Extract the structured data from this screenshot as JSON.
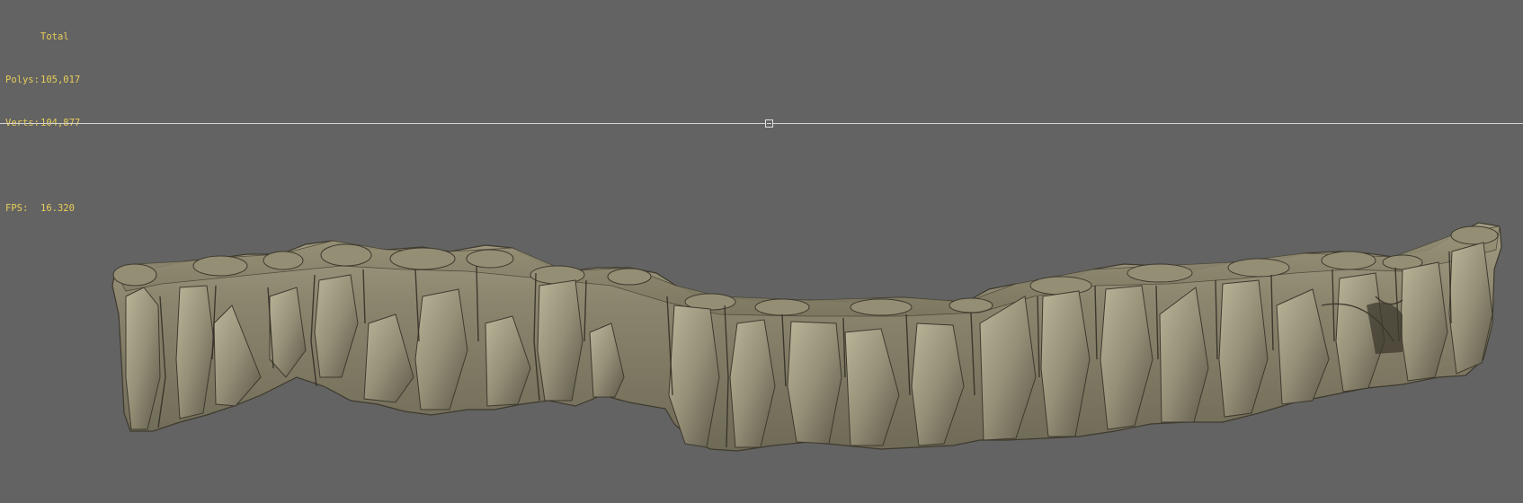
{
  "viewport_stats": {
    "header": "Total",
    "polys_label": "Polys:",
    "polys_value": "105,017",
    "verts_label": "Verts:",
    "verts_value": "104,877",
    "fps_label": "FPS:",
    "fps_value": "16.320"
  },
  "colors": {
    "background": "#636363",
    "stats_text": "#e8cd58",
    "horizon_line": "#d4d4d4",
    "rock_base": "#8c8671",
    "rock_light": "#b3ad93",
    "rock_shadow": "#3e3a2e"
  },
  "icons": {
    "viewport_control": "maximize-toggle-icon"
  }
}
